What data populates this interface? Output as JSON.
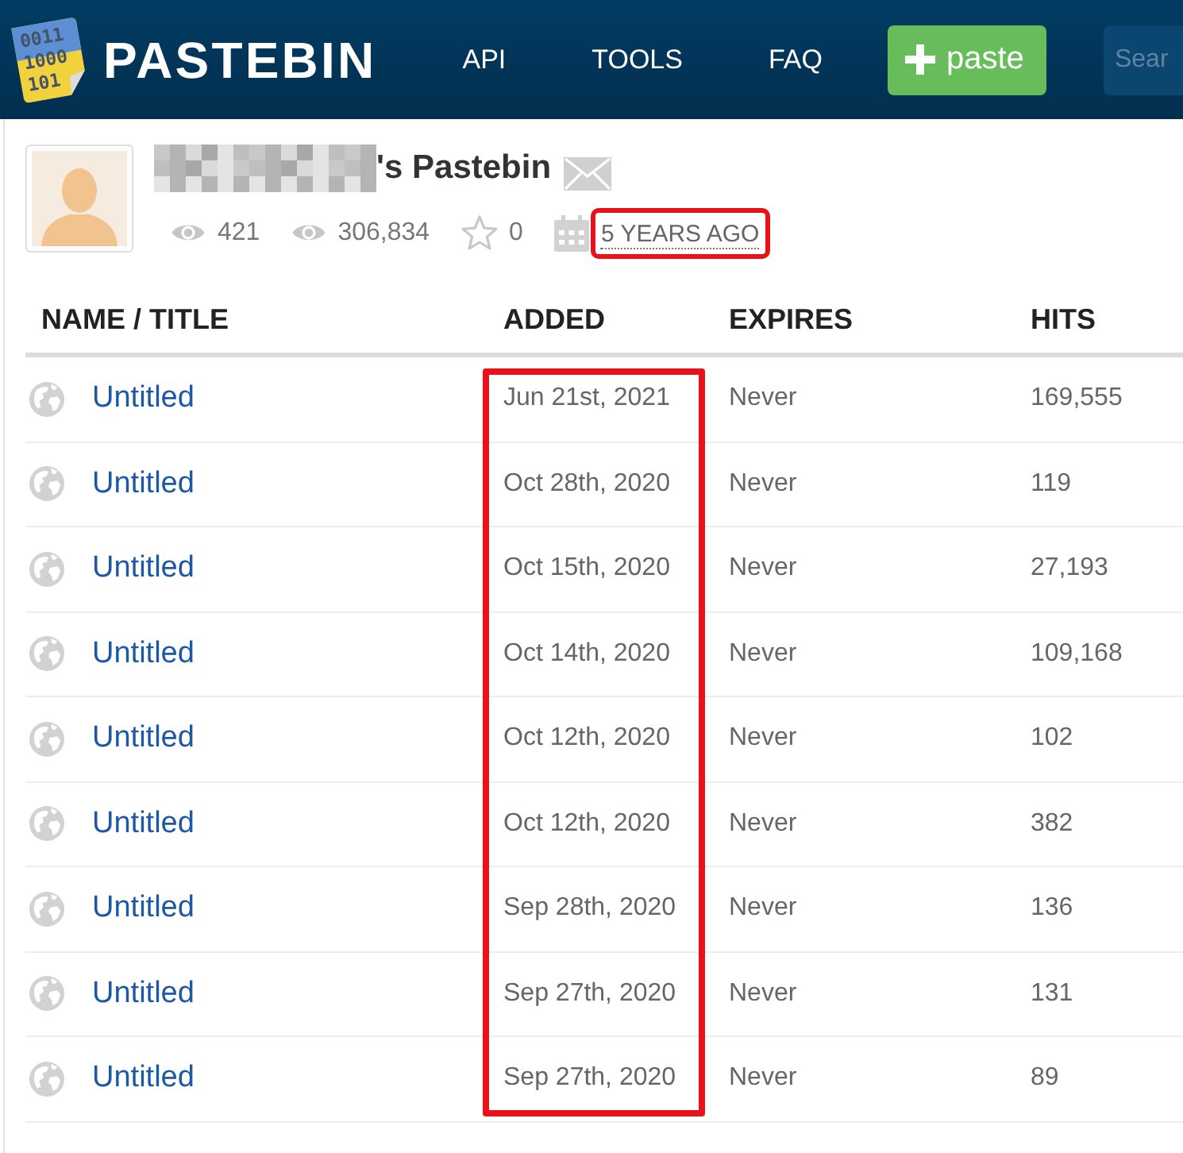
{
  "header": {
    "logo_digits": [
      "0011",
      "1000",
      "101"
    ],
    "logo_text": "PASTEBIN",
    "nav": [
      {
        "label": "API"
      },
      {
        "label": "TOOLS"
      },
      {
        "label": "FAQ"
      }
    ],
    "paste_button": {
      "label": "paste"
    },
    "search": {
      "placeholder": "Sear"
    }
  },
  "profile": {
    "title_suffix": "'s Pastebin",
    "stats": [
      {
        "kind": "views",
        "value": "421",
        "highlighted": false
      },
      {
        "kind": "views",
        "value": "306,834",
        "highlighted": false
      },
      {
        "kind": "rating",
        "value": "0",
        "highlighted": false
      },
      {
        "kind": "joined",
        "value": "5 YEARS AGO",
        "highlighted": true
      }
    ]
  },
  "table": {
    "columns": [
      {
        "label": "NAME / TITLE",
        "highlighted": false
      },
      {
        "label": "ADDED",
        "highlighted": true
      },
      {
        "label": "EXPIRES",
        "highlighted": false
      },
      {
        "label": "HITS",
        "highlighted": false
      }
    ],
    "rows": [
      {
        "title": "Untitled",
        "added": "Jun 21st, 2021",
        "expires": "Never",
        "hits": "169,555"
      },
      {
        "title": "Untitled",
        "added": "Oct 28th, 2020",
        "expires": "Never",
        "hits": "119"
      },
      {
        "title": "Untitled",
        "added": "Oct 15th, 2020",
        "expires": "Never",
        "hits": "27,193"
      },
      {
        "title": "Untitled",
        "added": "Oct 14th, 2020",
        "expires": "Never",
        "hits": "109,168"
      },
      {
        "title": "Untitled",
        "added": "Oct 12th, 2020",
        "expires": "Never",
        "hits": "102"
      },
      {
        "title": "Untitled",
        "added": "Oct 12th, 2020",
        "expires": "Never",
        "hits": "382"
      },
      {
        "title": "Untitled",
        "added": "Sep 28th, 2020",
        "expires": "Never",
        "hits": "136"
      },
      {
        "title": "Untitled",
        "added": "Sep 27th, 2020",
        "expires": "Never",
        "hits": "131"
      },
      {
        "title": "Untitled",
        "added": "Sep 27th, 2020",
        "expires": "Never",
        "hits": "89"
      }
    ]
  }
}
